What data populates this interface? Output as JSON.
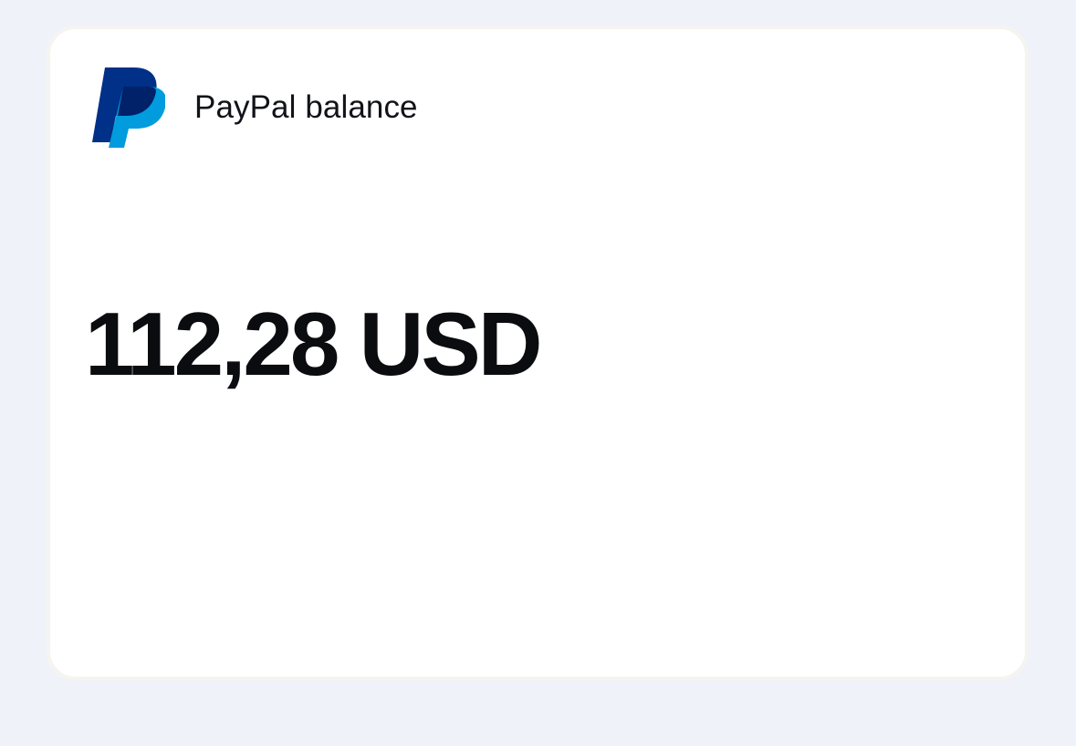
{
  "balance_card": {
    "title": "PayPal balance",
    "amount": "112,28 USD",
    "logo_icon": "paypal-logo-icon",
    "colors": {
      "page_background": "#eff2f9",
      "card_background": "#ffffff",
      "text": "#0b0c0f",
      "logo_dark_blue": "#003087",
      "logo_mid_blue": "#012169",
      "logo_light_blue": "#009cde"
    }
  }
}
